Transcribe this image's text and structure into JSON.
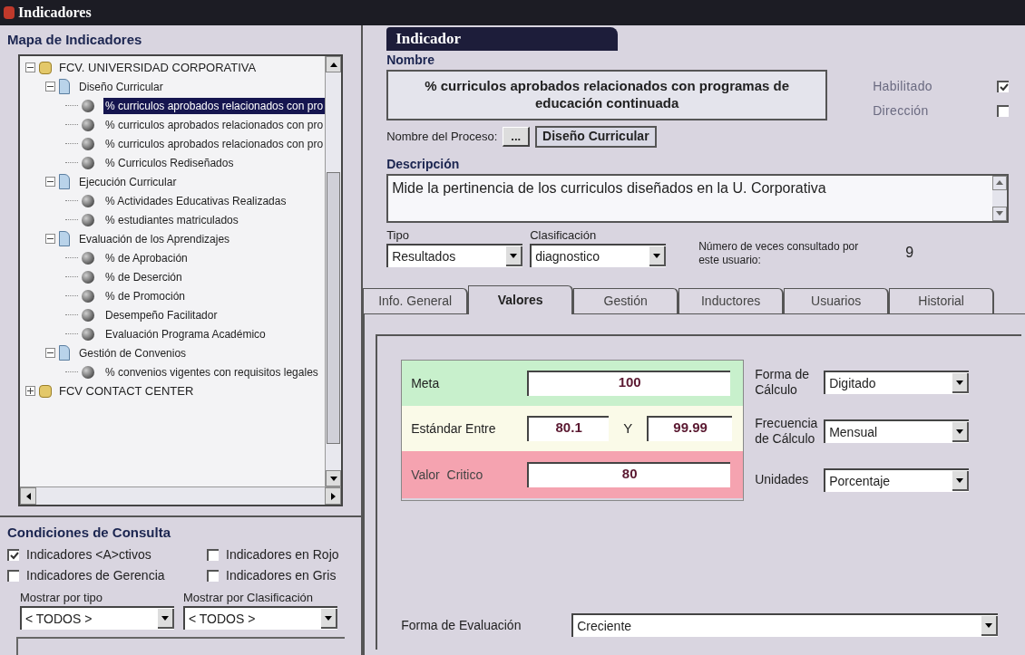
{
  "window": {
    "title": "Indicadores"
  },
  "tree_panel": {
    "title": "Mapa de Indicadores",
    "items": [
      {
        "label": "FCV. UNIVERSIDAD CORPORATIVA",
        "kind": "root",
        "expanded": true,
        "selected": false,
        "children": [
          {
            "label": "Diseño Curricular",
            "kind": "group",
            "expanded": true,
            "selected": false,
            "children": [
              {
                "label": "% curriculos aprobados relacionados con pro",
                "kind": "leaf",
                "selected": true
              },
              {
                "label": "% curriculos aprobados relacionados con pro",
                "kind": "leaf",
                "selected": false
              },
              {
                "label": "% curriculos aprobados relacionados con pro",
                "kind": "leaf",
                "selected": false
              },
              {
                "label": "% Curriculos Rediseñados",
                "kind": "leaf",
                "selected": false
              }
            ]
          },
          {
            "label": "Ejecución Curricular",
            "kind": "group",
            "expanded": true,
            "selected": false,
            "children": [
              {
                "label": "% Actividades Educativas Realizadas",
                "kind": "leaf",
                "selected": false
              },
              {
                "label": "% estudiantes matriculados",
                "kind": "leaf",
                "selected": false
              }
            ]
          },
          {
            "label": "Evaluación de los Aprendizajes",
            "kind": "group",
            "expanded": true,
            "selected": false,
            "children": [
              {
                "label": "% de Aprobación",
                "kind": "leaf",
                "selected": false
              },
              {
                "label": "% de Deserción",
                "kind": "leaf",
                "selected": false
              },
              {
                "label": "% de Promoción",
                "kind": "leaf",
                "selected": false
              },
              {
                "label": "Desempeño Facilitador",
                "kind": "leaf",
                "selected": false
              },
              {
                "label": "Evaluación Programa Académico",
                "kind": "leaf",
                "selected": false
              }
            ]
          },
          {
            "label": "Gestión de Convenios",
            "kind": "group",
            "expanded": true,
            "selected": false,
            "children": [
              {
                "label": "% convenios vigentes con requisitos legales",
                "kind": "leaf",
                "selected": false
              }
            ]
          }
        ]
      },
      {
        "label": "FCV CONTACT CENTER",
        "kind": "root",
        "expanded": false,
        "selected": false
      }
    ]
  },
  "conditions": {
    "title": "Condiciones de Consulta",
    "checkboxes": [
      {
        "label": "Indicadores <A>ctivos",
        "checked": true
      },
      {
        "label": "Indicadores en Rojo",
        "checked": false
      },
      {
        "label": "Indicadores de Gerencia",
        "checked": false
      },
      {
        "label": "Indicadores en Gris",
        "checked": false
      }
    ],
    "filters": [
      {
        "label": "Mostrar por tipo",
        "value": "< TODOS >"
      },
      {
        "label": "Mostrar por Clasificación",
        "value": "< TODOS >"
      }
    ]
  },
  "indicator": {
    "header": "Indicador",
    "name_label": "Nombre",
    "name": "% curriculos aprobados relacionados con programas de educación continuada",
    "flags": [
      {
        "label": "Habilitado",
        "checked": true
      },
      {
        "label": "Dirección",
        "checked": false
      }
    ],
    "process_label": "Nombre del Proceso:",
    "process_button": "...",
    "process": "Diseño Curricular",
    "description_label": "Descripción",
    "description": "Mide la pertinencia de los curriculos diseñados en la U. Corporativa",
    "tipo_label": "Tipo",
    "tipo": "Resultados",
    "clasificacion_label": "Clasificación",
    "clasificacion": "diagnostico",
    "consult_label": "Número de veces consultado por este usuario:",
    "consult_count": "9"
  },
  "tabs": [
    {
      "label": "Info. General",
      "selected": false
    },
    {
      "label": "Valores",
      "selected": true
    },
    {
      "label": "Gestión",
      "selected": false
    },
    {
      "label": "Inductores",
      "selected": false
    },
    {
      "label": "Usuarios",
      "selected": false
    },
    {
      "label": "Historial",
      "selected": false
    }
  ],
  "values": {
    "meta_label": "Meta",
    "meta": "100",
    "standard_label": "Estándar Entre",
    "standard_low": "80.1",
    "standard_sep": "Y",
    "standard_high": "99.99",
    "critical_label": "Valor  Critico",
    "critical": "80",
    "selects": [
      {
        "label": "Forma de Cálculo",
        "value": "Digitado"
      },
      {
        "label": "Frecuencia de Cálculo",
        "value": "Mensual"
      },
      {
        "label": "Unidades",
        "value": "Porcentaje"
      }
    ],
    "evaluation_label": "Forma de Evaluación",
    "evaluation": "Creciente"
  }
}
